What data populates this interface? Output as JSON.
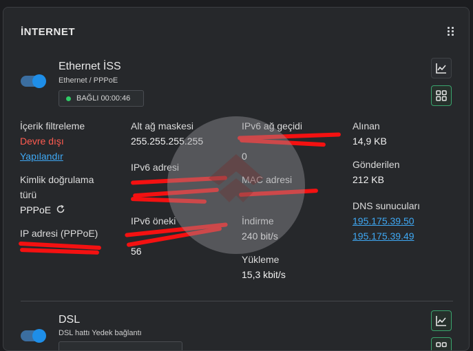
{
  "card": {
    "title": "İNTERNET"
  },
  "ethernet": {
    "name": "Ethernet İSS",
    "sub": "Ethernet / PPPoE",
    "status": "BAĞLI 00:00:46",
    "toggle_on": true,
    "col1": {
      "content_filter_label": "İçerik filtreleme",
      "content_filter_value": "Devre dışı",
      "configure_link": "Yapılandır",
      "auth_label_1": "Kimlik doğrulama",
      "auth_label_2": "türü",
      "auth_value": "PPPoE",
      "ip_label": "IP adresi (PPPoE)"
    },
    "col2": {
      "mask_label": "Alt ağ maskesi",
      "mask_value": "255.255.255.255",
      "ipv6_label": "IPv6 adresi",
      "prefix_label": "IPv6 öneki",
      "prefix_value_tail": "56"
    },
    "col3": {
      "gateway_label": "IPv6 ağ geçidi",
      "gateway_value_tail": "0",
      "mac_label": "MAC adresi",
      "download_label": "İndirme",
      "download_value": "240 bit/s",
      "upload_label": "Yükleme",
      "upload_value": "15,3 kbit/s"
    },
    "col4": {
      "received_label": "Alınan",
      "received_value": "14,9 KB",
      "sent_label": "Gönderilen",
      "sent_value": "212 KB",
      "dns_label": "DNS sunucuları",
      "dns": [
        "195.175.39.50",
        "195.175.39.49"
      ]
    }
  },
  "dsl": {
    "name": "DSL",
    "sub": "DSL hattı Yedek bağlantı",
    "toggle_on": true
  },
  "icons": {
    "chart": "chart-line-icon",
    "grid": "grid-icon",
    "drag": "drag-handle-icon",
    "refresh": "refresh-icon"
  },
  "colors": {
    "accent": "#1e8ee8",
    "status_ok": "#2fcc66",
    "disabled": "#ff5b50",
    "link": "#3fa9f5",
    "green_border": "#3aa56e"
  }
}
